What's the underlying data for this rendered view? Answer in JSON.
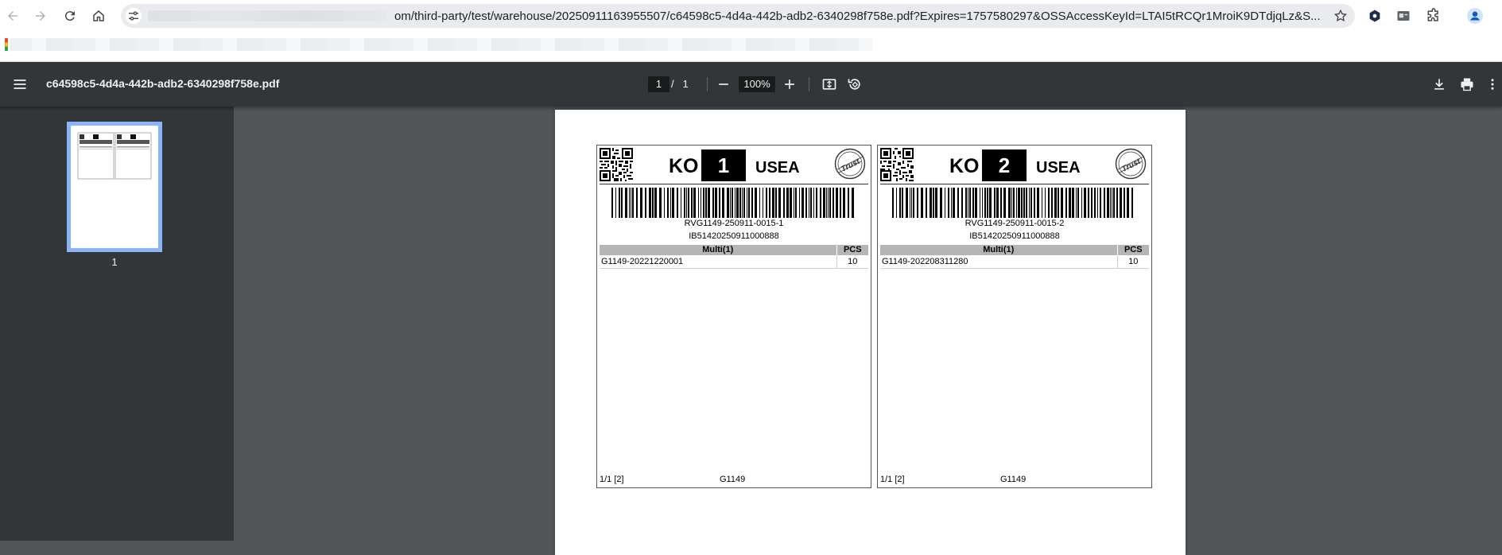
{
  "browser": {
    "url_visible": "om/third-party/test/warehouse/20250911163955507/c64598c5-4d4a-442b-adb2-6340298f758e.pdf?Expires=1757580297&OSSAccessKeyId=LTAI5tRCQr1MroiK9DTdjqLz&S..."
  },
  "pdf_viewer": {
    "file_name": "c64598c5-4d4a-442b-adb2-6340298f758e.pdf",
    "current_page": "1",
    "page_separator": "/",
    "total_pages": "1",
    "zoom": "100%",
    "thumbnail_label": "1"
  },
  "labels": [
    {
      "prefix": "KO",
      "number": "1",
      "destination": "USEA",
      "stamp_text": "Trust",
      "tracking_code": "RVG1149-250911-0015-1",
      "inbound_code": "IB51420250911000888",
      "table_header_item": "Multi(1)",
      "table_header_qty": "PCS",
      "rows": [
        {
          "sku": "G1149-20221220001",
          "qty": "10"
        }
      ],
      "footer_page": "1/1 [2]",
      "footer_code": "G1149"
    },
    {
      "prefix": "KO",
      "number": "2",
      "destination": "USEA",
      "stamp_text": "Trust",
      "tracking_code": "RVG1149-250911-0015-2",
      "inbound_code": "IB51420250911000888",
      "table_header_item": "Multi(1)",
      "table_header_qty": "PCS",
      "rows": [
        {
          "sku": "G1149-202208311280",
          "qty": "10"
        }
      ],
      "footer_page": "1/1 [2]",
      "footer_code": "G1149"
    }
  ],
  "colors": {
    "toolbar_bg": "#323639",
    "viewer_bg": "#525659",
    "thumbnail_selection": "#8ab4f8",
    "table_header_bg": "#b5b5b5"
  }
}
